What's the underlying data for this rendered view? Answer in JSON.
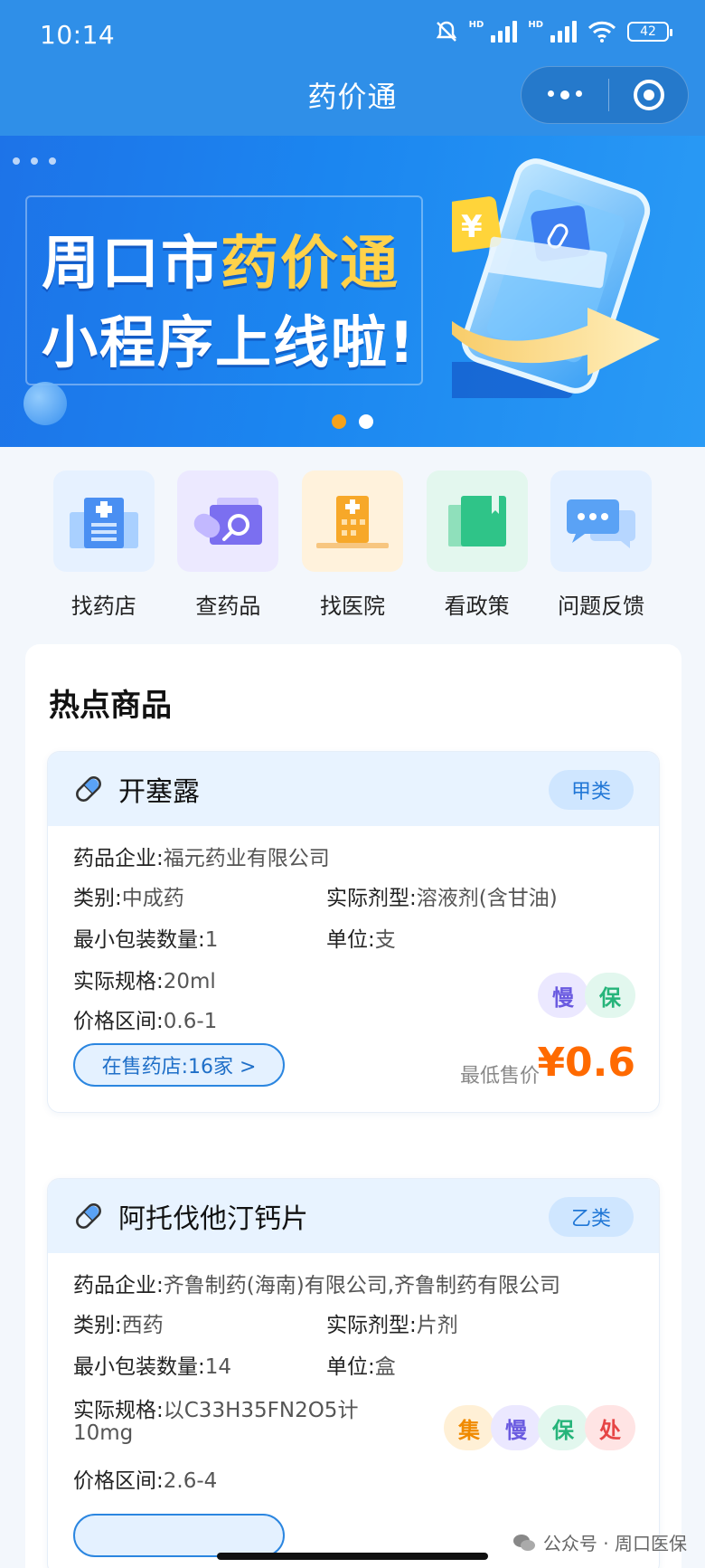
{
  "status_bar": {
    "time": "10:14",
    "hd1": "HD",
    "hd2": "HD",
    "battery": "42"
  },
  "nav": {
    "title": "药价通"
  },
  "banner": {
    "line1_pre": "周口市",
    "line1_hl": "药价通",
    "line2": "小程序上线啦!",
    "yen_symbol": "¥"
  },
  "quick_entries": [
    {
      "label": "找药店",
      "icon": "pharmacy-building-icon",
      "bg": "#e6f1ff"
    },
    {
      "label": "查药品",
      "icon": "medicine-search-icon",
      "bg": "#ece9ff"
    },
    {
      "label": "找医院",
      "icon": "hospital-building-icon",
      "bg": "#fff2dc"
    },
    {
      "label": "看政策",
      "icon": "policy-book-icon",
      "bg": "#e3f7ee"
    },
    {
      "label": "问题反馈",
      "icon": "feedback-chat-icon",
      "bg": "#e4f0ff"
    }
  ],
  "section_title": "热点商品",
  "products": [
    {
      "name": "开塞露",
      "grade": "甲类",
      "company_label": "药品企业:",
      "company": "福元药业有限公司",
      "category_label": "类别:",
      "category": "中成药",
      "form_label": "实际剂型:",
      "form": "溶液剂(含甘油)",
      "min_pack_label": "最小包装数量:",
      "min_pack": "1",
      "unit_label": "单位:",
      "unit": "支",
      "spec_label": "实际规格:",
      "spec": "20ml",
      "price_range_label": "价格区间:",
      "price_range": "0.6-1",
      "tags": [
        "慢",
        "保"
      ],
      "store_button": "在售药店:16家 >",
      "lowest_label": "最低售价",
      "lowest_price": "¥0.6"
    },
    {
      "name": "阿托伐他汀钙片",
      "grade": "乙类",
      "company_label": "药品企业:",
      "company": "齐鲁制药(海南)有限公司,齐鲁制药有限公司",
      "category_label": "类别:",
      "category": "西药",
      "form_label": "实际剂型:",
      "form": "片剂",
      "min_pack_label": "最小包装数量:",
      "min_pack": "14",
      "unit_label": "单位:",
      "unit": "盒",
      "spec_label": "实际规格:",
      "spec": "以C33H35FN2O5计",
      "spec_line2": "10mg",
      "price_range_label": "价格区间:",
      "price_range": "2.6-4",
      "tags": [
        "集",
        "慢",
        "保",
        "处"
      ]
    }
  ],
  "watermark": "公众号 · 周口医保",
  "colors": {
    "primary": "#2f8fe8",
    "price": "#ff6a00",
    "accent_dot": "#f6a21a"
  }
}
